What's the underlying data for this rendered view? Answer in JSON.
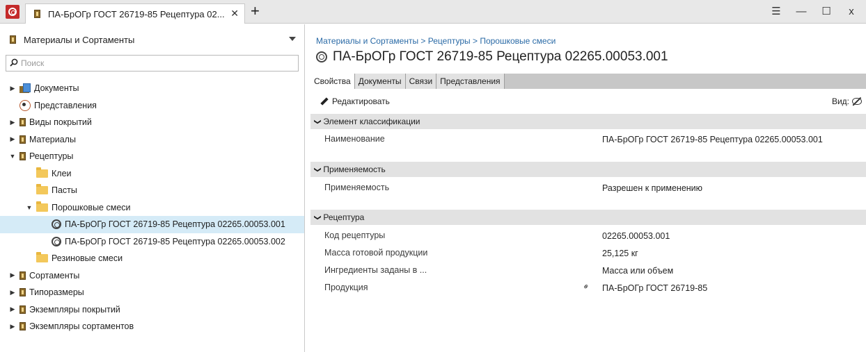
{
  "titlebar": {
    "tab_title": "ПА-БрОГр ГОСТ 26719-85 Рецептура 02...",
    "close_glyph": "✕",
    "new_tab_glyph": "+",
    "menu_glyph": "☰",
    "minimize_glyph": "—",
    "maximize_glyph": "☐",
    "close_window_glyph": "x"
  },
  "left": {
    "header_label": "Материалы и Сортаменты",
    "search_placeholder": "Поиск",
    "tree": [
      {
        "label": "Документы",
        "expander": "▶"
      },
      {
        "label": "Представления",
        "expander": ""
      },
      {
        "label": "Виды покрытий",
        "expander": "▶"
      },
      {
        "label": "Материалы",
        "expander": "▶"
      },
      {
        "label": "Рецептуры",
        "expander": "▼"
      },
      {
        "label": "Клеи",
        "expander": ""
      },
      {
        "label": "Пасты",
        "expander": ""
      },
      {
        "label": "Порошковые смеси",
        "expander": "▼"
      },
      {
        "label": "ПА-БрОГр ГОСТ 26719-85 Рецептура 02265.00053.001",
        "expander": ""
      },
      {
        "label": "ПА-БрОГр ГОСТ 26719-85 Рецептура 02265.00053.002",
        "expander": ""
      },
      {
        "label": "Резиновые смеси",
        "expander": ""
      },
      {
        "label": "Сортаменты",
        "expander": "▶"
      },
      {
        "label": "Типоразмеры",
        "expander": "▶"
      },
      {
        "label": "Экземпляры покрытий",
        "expander": "▶"
      },
      {
        "label": "Экземпляры сортаментов",
        "expander": "▶"
      }
    ]
  },
  "right": {
    "breadcrumb": [
      "Материалы и Сортаменты",
      " > ",
      "Рецептуры",
      " > ",
      "Порошковые смеси"
    ],
    "title": "ПА-БрОГр ГОСТ 26719-85 Рецептура 02265.00053.001",
    "tabs": [
      "Свойства",
      "Документы",
      "Связи",
      "Представления"
    ],
    "edit_label": "Редактировать",
    "view_label": "Вид:",
    "sections": [
      {
        "title": "Элемент классификации"
      },
      {
        "title": "Применяемость"
      },
      {
        "title": "Рецептура"
      }
    ],
    "props": {
      "name_key": "Наименование",
      "name_val": "ПА-БрОГр ГОСТ 26719-85 Рецептура 02265.00053.001",
      "applic_key": "Применяемость",
      "applic_val": "Разрешен к применению",
      "code_key": "Код рецептуры",
      "code_val": "02265.00053.001",
      "mass_key": "Масса готовой продукции",
      "mass_val": "25,125  кг",
      "ingr_key": "Ингредиенты заданы в ...",
      "ingr_val": "Масса или объем",
      "prod_key": "Продукция",
      "prod_val": "ПА-БрОГр ГОСТ 26719-85"
    },
    "chevron_glyph": "❯",
    "link_glyph": "⚭"
  }
}
